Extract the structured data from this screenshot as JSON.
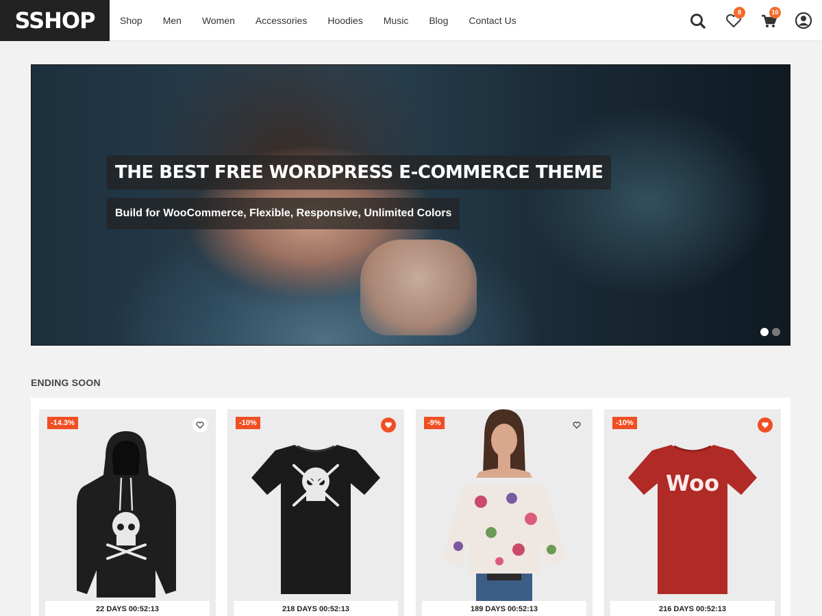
{
  "brand": {
    "logo": "SSHOP"
  },
  "nav": [
    "Shop",
    "Men",
    "Women",
    "Accessories",
    "Hoodies",
    "Music",
    "Blog",
    "Contact Us"
  ],
  "header": {
    "wishlist_count": "8",
    "cart_count": "10"
  },
  "hero": {
    "title": "THE BEST FREE WORDPRESS E-COMMERCE THEME",
    "subtitle": "Build for WooCommerce, Flexible, Responsive, Unlimited Colors",
    "slides": 2,
    "active_slide": 1
  },
  "section": {
    "title": "ENDING SOON"
  },
  "products": [
    {
      "discount": "-14.3%",
      "wishlisted": false,
      "timer": "22 DAYS 00:52:13",
      "image": "black-skull-hoodie"
    },
    {
      "discount": "-10%",
      "wishlisted": true,
      "timer": "218 DAYS 00:52:13",
      "image": "black-skull-tshirt"
    },
    {
      "discount": "-9%",
      "wishlisted": false,
      "timer": "189 DAYS 00:52:13",
      "image": "floral-off-shoulder-top"
    },
    {
      "discount": "-10%",
      "wishlisted": true,
      "timer": "216 DAYS 00:52:13",
      "image": "red-woo-tshirt",
      "print_text": "Woo"
    }
  ],
  "colors": {
    "accent": "#f04e23",
    "badge": "#f26b2b",
    "logo_bg": "#222222"
  }
}
